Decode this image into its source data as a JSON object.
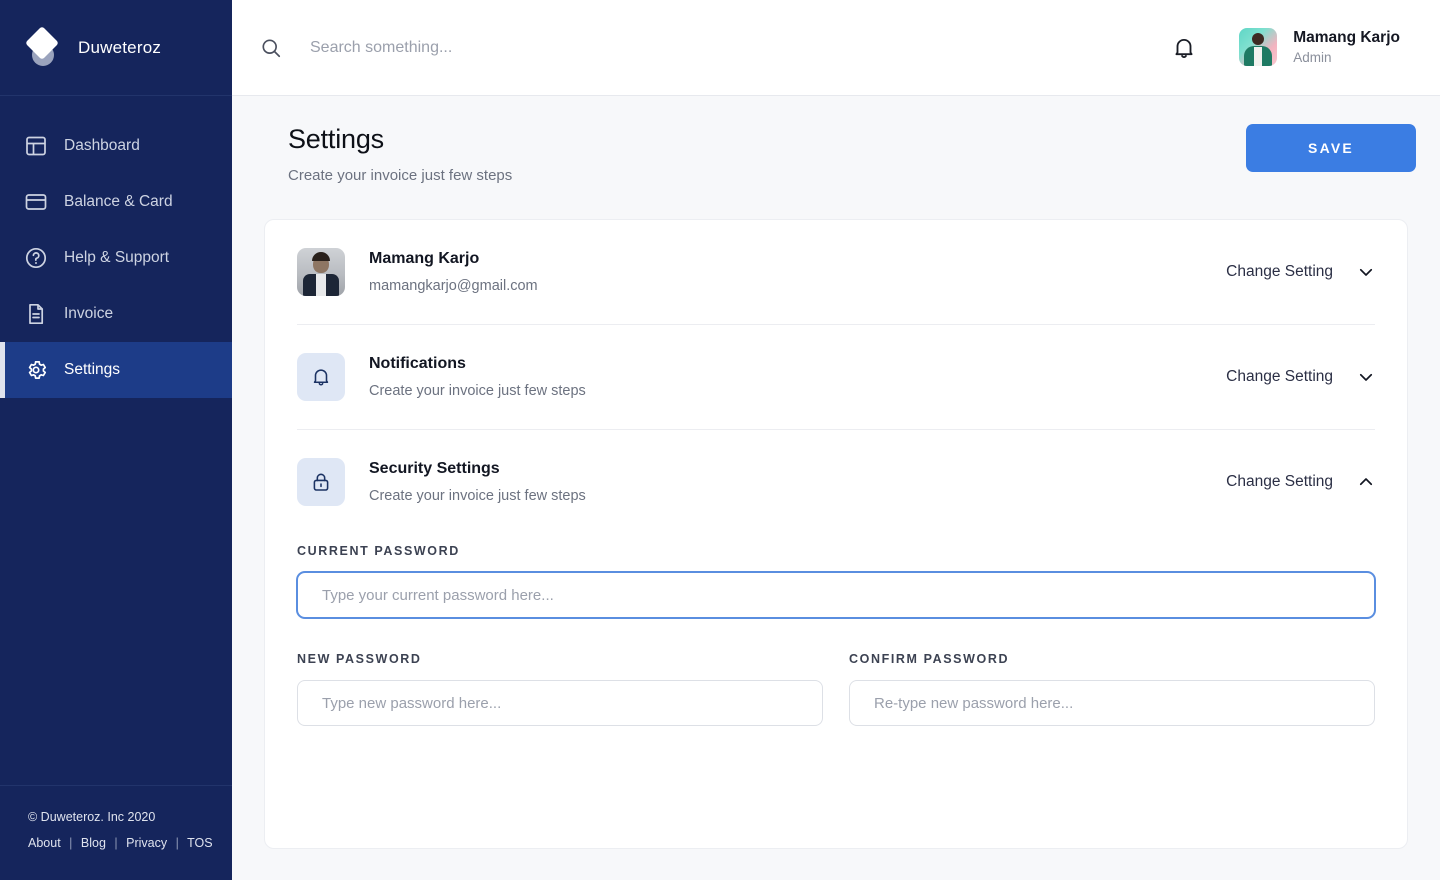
{
  "sidebar": {
    "brand": {
      "name": "Duweteroz",
      "logo_icon": "diamond-logo"
    },
    "items": [
      {
        "label": "Dashboard",
        "icon": "dashboard-icon",
        "active": false
      },
      {
        "label": "Balance & Card",
        "icon": "card-icon",
        "active": false
      },
      {
        "label": "Help & Support",
        "icon": "help-circle-icon",
        "active": false
      },
      {
        "label": "Invoice",
        "icon": "document-icon",
        "active": false
      },
      {
        "label": "Settings",
        "icon": "gear-icon",
        "active": true
      }
    ],
    "footer": {
      "copyright": "© Duweteroz. Inc 2020",
      "links": [
        "About",
        "Blog",
        "Privacy",
        "TOS"
      ],
      "separator": "|"
    }
  },
  "topbar": {
    "search": {
      "placeholder": "Search something...",
      "value": "",
      "icon": "search-icon"
    },
    "notification_icon": "bell-icon",
    "user": {
      "name": "Mamang Karjo",
      "role": "Admin",
      "avatar": "user-photo-avatar"
    }
  },
  "page": {
    "title": "Settings",
    "subtitle": "Create your invoice just few steps",
    "save_label": "SAVE"
  },
  "settings_rows": [
    {
      "title": "Mamang Karjo",
      "desc": "mamangkarjo@gmail.com",
      "icon": "profile-photo",
      "action_label": "Change Setting",
      "chevron": "chevron-down-icon",
      "expanded": false
    },
    {
      "title": "Notifications",
      "desc": "Create your invoice just few steps",
      "icon": "bell-icon",
      "action_label": "Change Setting",
      "chevron": "chevron-down-icon",
      "expanded": false
    },
    {
      "title": "Security Settings",
      "desc": "Create your invoice just few steps",
      "icon": "lock-icon",
      "action_label": "Change Setting",
      "chevron": "chevron-up-icon",
      "expanded": true
    }
  ],
  "security_form": {
    "current_password": {
      "label": "CURRENT PASSWORD",
      "placeholder": "Type your current password here...",
      "value": "",
      "focused": true
    },
    "new_password": {
      "label": "NEW PASSWORD",
      "placeholder": "Type new password here...",
      "value": "",
      "focused": false
    },
    "confirm_password": {
      "label": "CONFIRM PASSWORD",
      "placeholder": "Re-type new password here...",
      "value": "",
      "focused": false
    }
  },
  "colors": {
    "sidebar_bg": "#15255C",
    "sidebar_active": "#1D3C88",
    "accent_blue": "#3B7DE3",
    "page_bg": "#F7F8FA",
    "icon_tile_bg": "#DFE7F5",
    "focus_border": "#5A8EE0"
  }
}
